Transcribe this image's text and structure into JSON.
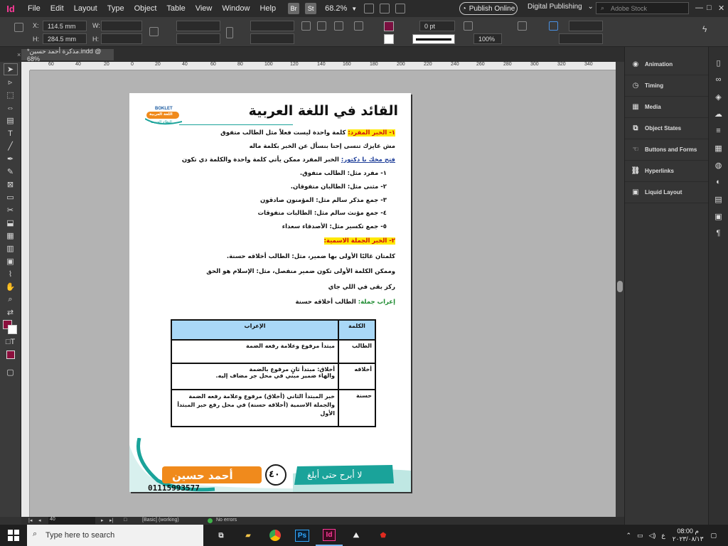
{
  "menubar": {
    "app_icon": "Id",
    "items": [
      "File",
      "Edit",
      "Layout",
      "Type",
      "Object",
      "Table",
      "View",
      "Window",
      "Help"
    ],
    "bridge": "Br",
    "stock": "St",
    "zoom": "68.2%",
    "publish": "Publish Online",
    "workspace": "Digital Publishing",
    "stock_search_placeholder": "Adobe Stock"
  },
  "control_panel": {
    "x_label": "X:",
    "x_value": "114.5 mm",
    "y_label": "H:",
    "y_value": "284.5 mm",
    "w_label": "W:",
    "h_label": "H:",
    "stroke_value": "0 pt",
    "scale_value": "100%"
  },
  "document_tab": {
    "label": "*مذكرة أحمد حسين.indd @ 68%"
  },
  "ruler": {
    "ticks": [
      "60",
      "40",
      "20",
      "0",
      "20",
      "40",
      "60",
      "80",
      "100",
      "120",
      "140",
      "160",
      "180",
      "200",
      "220",
      "240",
      "260",
      "280",
      "300",
      "320",
      "340"
    ]
  },
  "document": {
    "title": "القائد في اللغة العربية",
    "booklet_line1": "BOKLET",
    "booklet_line2": "اللغة العربية",
    "booklet_line3": "النظام الحديث",
    "l1_head": "١- الخبر المفرد:",
    "l1_text": " كلمة واحدة ليست فعلاً مثل الطالب متفوق",
    "l2": "مش عايزك تنسى إحنا بنسأل عن الخبر بكلمة ماله",
    "l3_head": "فتح مخك يا دكتور:",
    "l3_text": " الخبر المفرد ممكن يأتي كلمة واحدة والكلمة دي تكون",
    "l4": "١- مفرد مثل: الطالب متفوق.",
    "l5": "٢- مثنى مثل: الطالبان متفوقان.",
    "l6": "٣- جمع مذكر سالم مثل: المؤمنون صادقون",
    "l7": "٤- جمع مؤنث سالم مثل: الطالبات متفوقات",
    "l8": "٥- جمع تكسير مثل: الأصدقاء سعداء",
    "l9": "٢- الخبر الجملة الاسمية:",
    "l10": "كلمتان غالبًا الأولى بها ضمير، مثل: الطالب أخلاقه حسنة.",
    "l11": "وممكن الكلمة الأولى تكون ضمير منفصل، مثل: الإسلام هو الحق",
    "l12": "ركز بقى في اللي جاي",
    "l13_head": "إعراب جملة:",
    "l13_text": " الطالب أخلاقه حسنة",
    "table": {
      "head_word": "الكلمة",
      "head_parse": "الإعراب",
      "rows": [
        {
          "word": "الطالب",
          "parse": "مبتدأ مرفوع وعلامة رفعه الضمة"
        },
        {
          "word": "أخلاقه",
          "parse": "أخلاق: مبتدأ ثانٍ مرفوع بالضمة\nوالهاء ضمير مبني في محل جر مضاف إليه."
        },
        {
          "word": "حسنة",
          "parse": "خبر المبتدأ الثاني (أخلاق) مرفوع وعلامة رفعه الضمة والجملة الاسمية (أخلاقه حسنة) في محل رفع خبر المبتدأ الأول"
        }
      ]
    },
    "footer_name": "أحمد حسين",
    "footer_page": "٤٠",
    "footer_slogan": "لا أبرح حتى أبلغ",
    "footer_phone": "01115993577"
  },
  "statusbar": {
    "page": "40",
    "style": "[Basic] (working)",
    "errors": "No errors"
  },
  "panels": {
    "items": [
      "Animation",
      "Timing",
      "Media",
      "Object States",
      "Buttons and Forms",
      "Hyperlinks",
      "Liquid Layout"
    ]
  },
  "taskbar": {
    "search_placeholder": "Type here to search",
    "apps": [
      "Ps",
      "Id"
    ],
    "time": "08:00 م",
    "date": "٢٠٢٣/٠٨/١٣",
    "lang": "ع"
  },
  "colors": {
    "accent_pink": "#ff3a9a",
    "highlight_yellow": "#ffe800",
    "table_head": "#a9d8f7",
    "footer_teal": "#1aa39a",
    "footer_orange": "#f08a1c"
  }
}
